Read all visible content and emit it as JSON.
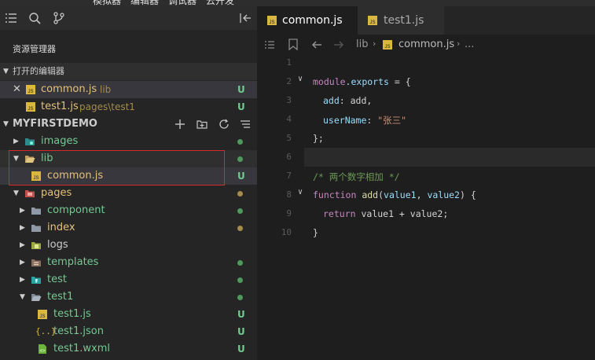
{
  "menu": [
    "模拟器",
    "编辑器",
    "调试器",
    "云开发"
  ],
  "sidebar": {
    "title": "资源管理器",
    "open_editors_header": "打开的编辑器",
    "open_editors": [
      {
        "name": "common.js",
        "path": "lib",
        "status": "U"
      },
      {
        "name": "test1.js",
        "path": "pages\\test1",
        "status": "U"
      }
    ],
    "project_header": "MYFIRSTDEMO",
    "tree": [
      {
        "label": "images"
      },
      {
        "label": "lib"
      },
      {
        "label": "common.js",
        "status": "U"
      },
      {
        "label": "pages"
      },
      {
        "label": "component"
      },
      {
        "label": "index"
      },
      {
        "label": "logs"
      },
      {
        "label": "templates"
      },
      {
        "label": "test"
      },
      {
        "label": "test1"
      },
      {
        "label": "test1.js",
        "status": "U"
      },
      {
        "label": "test1.json",
        "status": "U"
      },
      {
        "label": "test1.wxml",
        "status": "U"
      }
    ],
    "colors": {
      "green_dot": "#4e9a5c",
      "orange_dot": "#a58b4c",
      "highlight_box": "#d62a2a",
      "untracked": "#73c991"
    }
  },
  "editor": {
    "tabs": [
      {
        "label": "common.js",
        "active": true
      },
      {
        "label": "test1.js",
        "active": false
      }
    ],
    "breadcrumb": {
      "folder": "lib",
      "file": "common.js",
      "more": "..."
    },
    "line_numbers": [
      "1",
      "2",
      "3",
      "4",
      "5",
      "6",
      "7",
      "8",
      "9",
      "10"
    ],
    "code": {
      "l2_a": "module",
      "l2_b": ".exports",
      "l2_c": " = {",
      "l3_a": "add",
      "l3_b": ": add,",
      "l4_a": "userName",
      "l4_b": ": ",
      "l4_c": "\"张三\"",
      "l5": "};",
      "l7": "/* 两个数字相加 */",
      "l8_a": "function",
      "l8_b": " add",
      "l8_c": "(",
      "l8_d": "value1",
      "l8_e": ", ",
      "l8_f": "value2",
      "l8_g": ") {",
      "l9_a": "return",
      "l9_b": " value1 + value2;",
      "l10": "}"
    }
  }
}
